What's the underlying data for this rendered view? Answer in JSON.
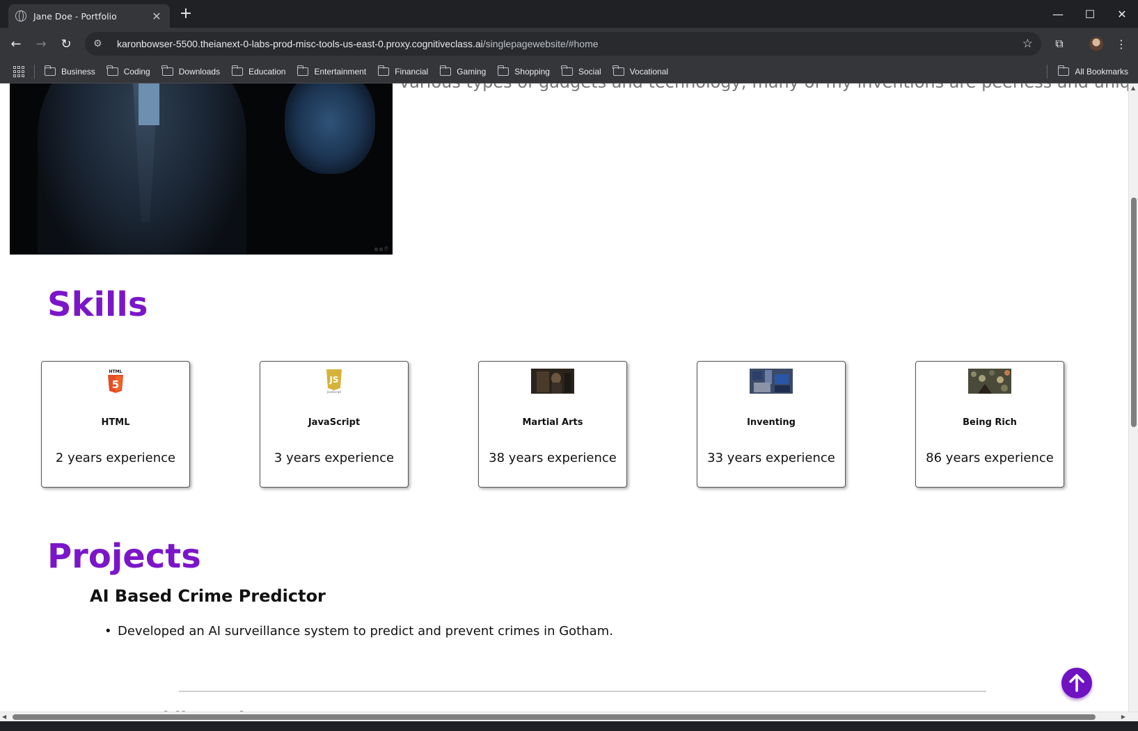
{
  "browser": {
    "tab_title": "Jane Doe - Portfolio",
    "url_host": "karonbowser-5500.theianext-0-labs-prod-misc-tools-us-east-0.proxy.cognitiveclass.ai",
    "url_path": "/singlepagewebsite/#home",
    "bookmarks": [
      "Business",
      "Coding",
      "Downloads",
      "Education",
      "Entertainment",
      "Financial",
      "Gaming",
      "Shopping",
      "Social",
      "Vocational"
    ],
    "all_bookmarks": "All Bookmarks"
  },
  "about": {
    "partial_text": "various types of gadgets and technology; many of my inventions are peerless and unique."
  },
  "skills": {
    "heading": "Skills",
    "items": [
      {
        "name": "HTML",
        "experience": "2 years experience",
        "icon": "html5-icon"
      },
      {
        "name": "JavaScript",
        "experience": "3 years experience",
        "icon": "javascript-icon"
      },
      {
        "name": "Martial Arts",
        "experience": "38 years experience",
        "icon": "martial-arts-photo"
      },
      {
        "name": "Inventing",
        "experience": "33 years experience",
        "icon": "inventing-photo"
      },
      {
        "name": "Being Rich",
        "experience": "86 years experience",
        "icon": "money-photo"
      }
    ]
  },
  "projects": {
    "heading": "Projects",
    "items": [
      {
        "title": "AI Based Crime Predictor",
        "bullets": [
          "Developed an AI surveillance system to predict and prevent crimes in Gotham."
        ]
      },
      {
        "title": "Automobile Designer"
      }
    ]
  },
  "colors": {
    "accent": "#7b16c8",
    "chrome_bg": "#202124",
    "toolbar_bg": "#35363a"
  }
}
